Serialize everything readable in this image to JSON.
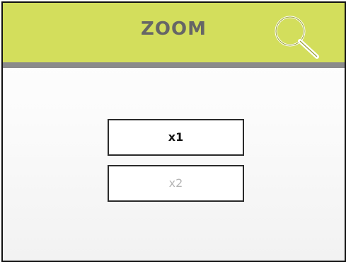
{
  "header": {
    "title": "ZOOM",
    "icon": "search-icon",
    "background_color": "#d3de5c",
    "rule_color": "#8a8a8a",
    "title_color": "#666666"
  },
  "zoom_options": [
    {
      "label": "x1",
      "selected": true
    },
    {
      "label": "x2",
      "selected": false
    }
  ]
}
